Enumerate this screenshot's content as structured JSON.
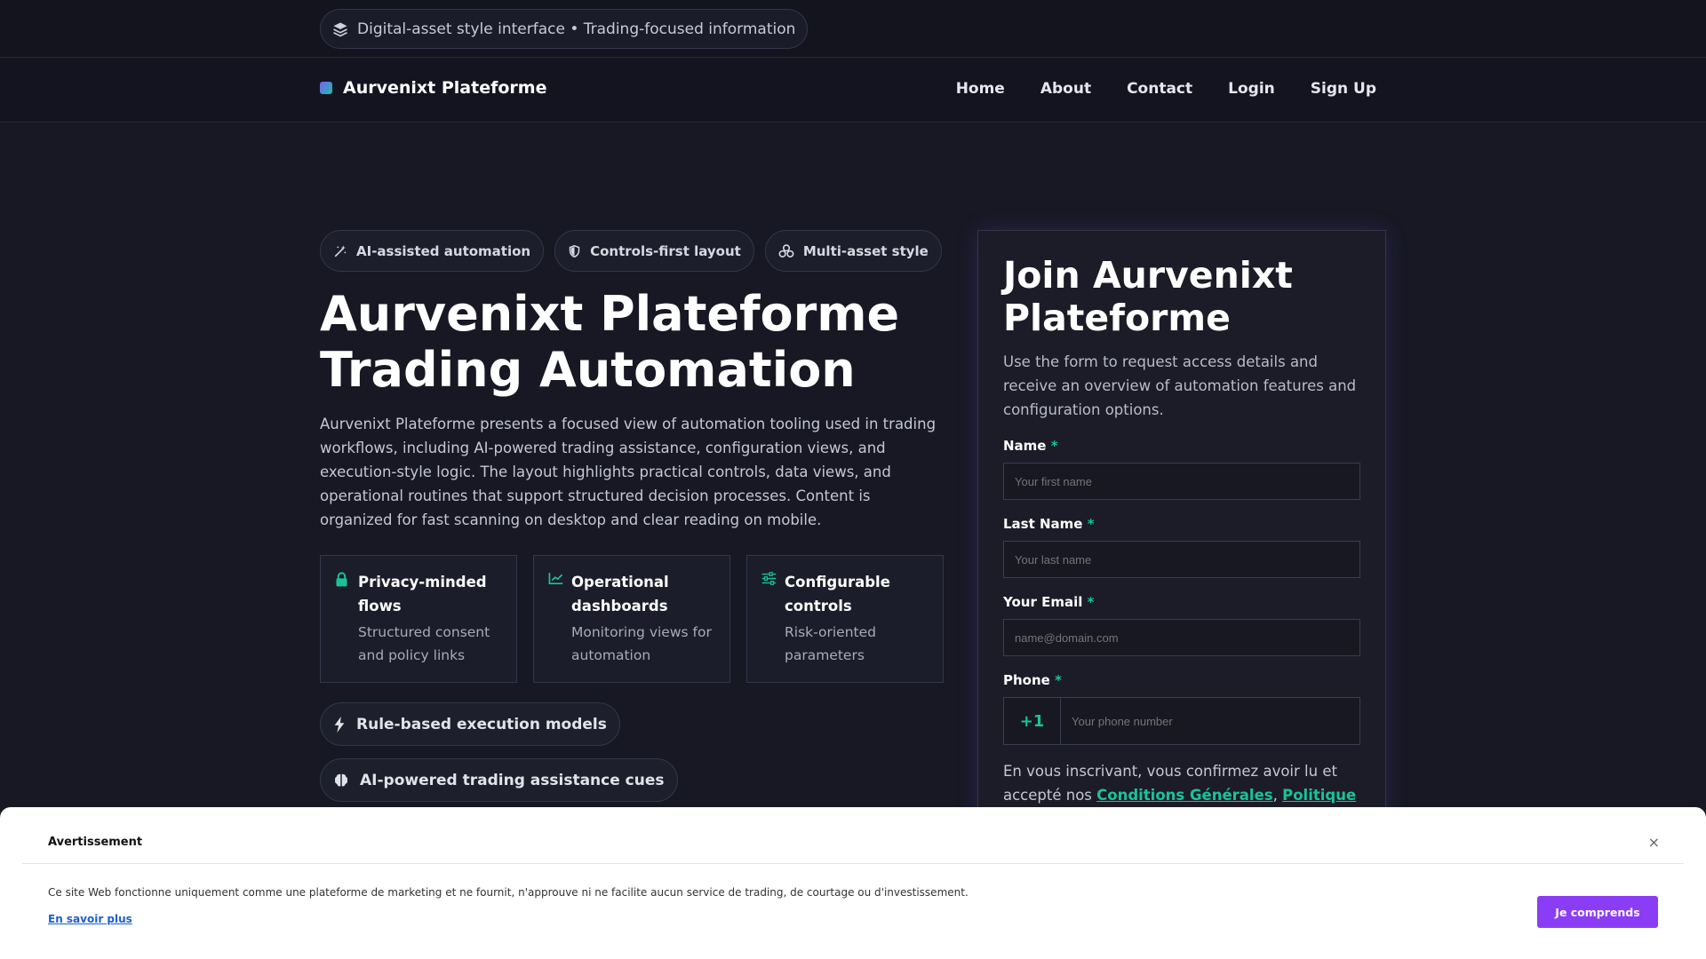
{
  "topbar": {
    "pill_text": "Digital-asset style interface • Trading-focused information",
    "pill_icon": "layers-icon"
  },
  "navbar": {
    "brand": "Aurvenixt Plateforme",
    "links": [
      "Home",
      "About",
      "Contact",
      "Login",
      "Sign Up"
    ]
  },
  "hero": {
    "chips": [
      {
        "label": "AI-assisted automation",
        "icon": "magic-wand-icon"
      },
      {
        "label": "Controls-first layout",
        "icon": "shield-icon"
      },
      {
        "label": "Multi-asset style",
        "icon": "coins-icon"
      }
    ],
    "title_line1": "Aurvenixt Plateforme",
    "title_line2": "Trading Automation",
    "description": "Aurvenixt Plateforme presents a focused view of automation tooling used in trading workflows, including AI-powered trading assistance, configuration views, and execution-style logic. The layout highlights practical controls, data views, and operational routines that support structured decision processes. Content is organized for fast scanning on desktop and clear reading on mobile.",
    "features": [
      {
        "title": "Privacy-minded flows",
        "desc": "Structured consent and policy links",
        "icon": "lock-icon"
      },
      {
        "title": "Operational dashboards",
        "desc": "Monitoring views for automation",
        "icon": "chart-line-icon"
      },
      {
        "title": "Configurable controls",
        "desc": "Risk-oriented parameters",
        "icon": "sliders-icon"
      }
    ],
    "pill_1": {
      "label": "Rule-based execution models",
      "icon": "bolt-icon"
    },
    "pill_2": {
      "label": "AI-powered trading assistance cues",
      "icon": "brain-icon"
    }
  },
  "form": {
    "title": "Join Aurvenixt Plateforme",
    "description": "Use the form to request access details and receive an overview of automation features and configuration options.",
    "name_label": "Name",
    "name_placeholder": "Your first name",
    "lastname_label": "Last Name",
    "lastname_placeholder": "Your last name",
    "email_label": "Your Email",
    "email_placeholder": "name@domain.com",
    "phone_label": "Phone",
    "phone_code": "+1",
    "phone_placeholder": "Your phone number",
    "required_mark": "*",
    "consent_text": "En vous inscrivant, vous confirmez avoir lu et accepté nos ",
    "terms_link": "Conditions Générales",
    "comma": ", ",
    "policy_link": "Politique de"
  },
  "modal": {
    "title": "Avertissement",
    "text": "Ce site Web fonctionne uniquement comme une plateforme de marketing et ne fournit, n'approuve ni ne facilite aucun service de trading, de courtage ou d'investissement.",
    "link": "En savoir plus",
    "button": "Je comprends",
    "close": "×"
  },
  "colors": {
    "background": "#171823",
    "accent_green": "#19c39a",
    "accent_purple": "#8b3cf5"
  }
}
